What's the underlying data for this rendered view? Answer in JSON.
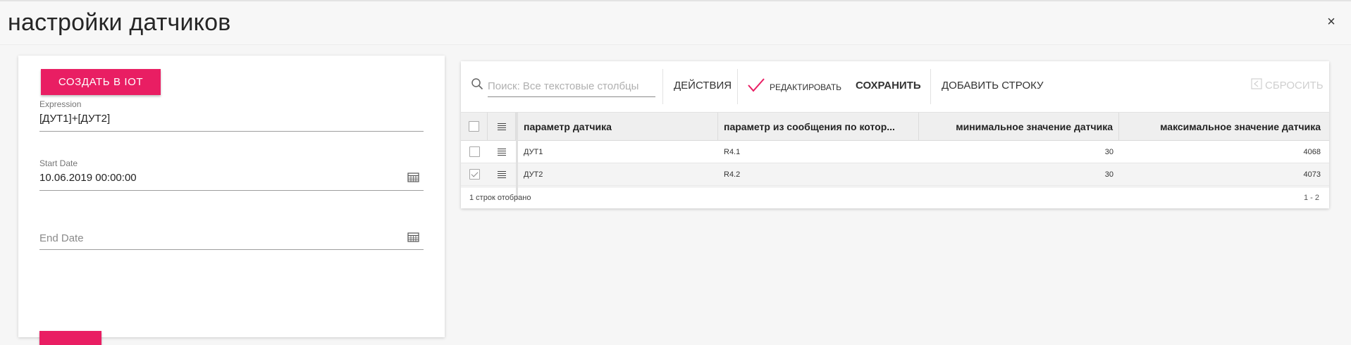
{
  "header": {
    "title": "настройки датчиков",
    "close_glyph": "×"
  },
  "form": {
    "create_button": "СОЗДАТЬ В IOT",
    "expression": {
      "label": "Expression",
      "value": "[ДУТ1]+[ДУТ2]"
    },
    "start_date": {
      "label": "Start Date",
      "value": "10.06.2019 00:00:00"
    },
    "end_date": {
      "placeholder": "End Date"
    }
  },
  "toolbar": {
    "search_placeholder": "Поиск: Все текстовые столбцы",
    "actions": "ДЕЙСТВИЯ",
    "edit": "РЕДАКТИРОВАТЬ",
    "save": "СОХРАНИТЬ",
    "add_row": "ДОБАВИТЬ СТРОКУ",
    "reset": "СБРОСИТЬ"
  },
  "grid": {
    "columns": [
      "параметр датчика",
      "параметр из сообщения по котор...",
      "минимальное значение датчика",
      "максимальное значение датчика"
    ],
    "rows": [
      {
        "checked": false,
        "sensor": "ДУТ1",
        "message_param": "R4.1",
        "min": "30",
        "max": "4068"
      },
      {
        "checked": true,
        "sensor": "ДУТ2",
        "message_param": "R4.2",
        "min": "30",
        "max": "4073"
      }
    ],
    "footer_count": "1 строк отобрано",
    "footer_range": "1 - 2"
  },
  "colors": {
    "accent": "#e91e63",
    "header_bg": "#efefef"
  },
  "icons": {
    "search": "search-icon",
    "edit": "check-icon",
    "reset": "reset-icon",
    "calendar": "calendar-icon",
    "row_menu": "lines-icon"
  }
}
